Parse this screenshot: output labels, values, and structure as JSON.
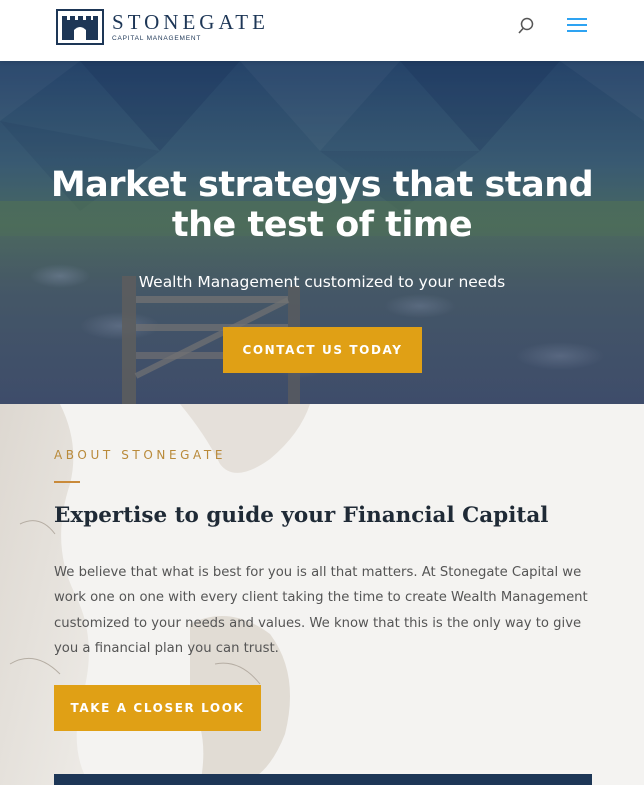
{
  "header": {
    "logo_name": "STONEGATE",
    "logo_sub": "CAPITAL MANAGEMENT",
    "search_icon": "search-icon",
    "menu_icon": "hamburger-menu-icon",
    "brand_color": "#1d3656",
    "menu_color": "#2ea3f2"
  },
  "hero": {
    "title": "Market strategys that stand the test of time",
    "subtitle": "Wealth Management customized to your needs",
    "cta_label": "CONTACT US TODAY",
    "accent_color": "#e0a015"
  },
  "about": {
    "eyebrow": "ABOUT STONEGATE",
    "title": "Expertise to guide your Financial Capital",
    "body": "We believe that what is best for you is all that matters. At Stonegate Capital we work one on one with every client taking the time to create Wealth Management customized to your needs and values. We know that this is the only way to give you a financial plan you can trust.",
    "cta_label": "TAKE A CLOSER LOOK",
    "eyebrow_color": "#b98a3a"
  }
}
